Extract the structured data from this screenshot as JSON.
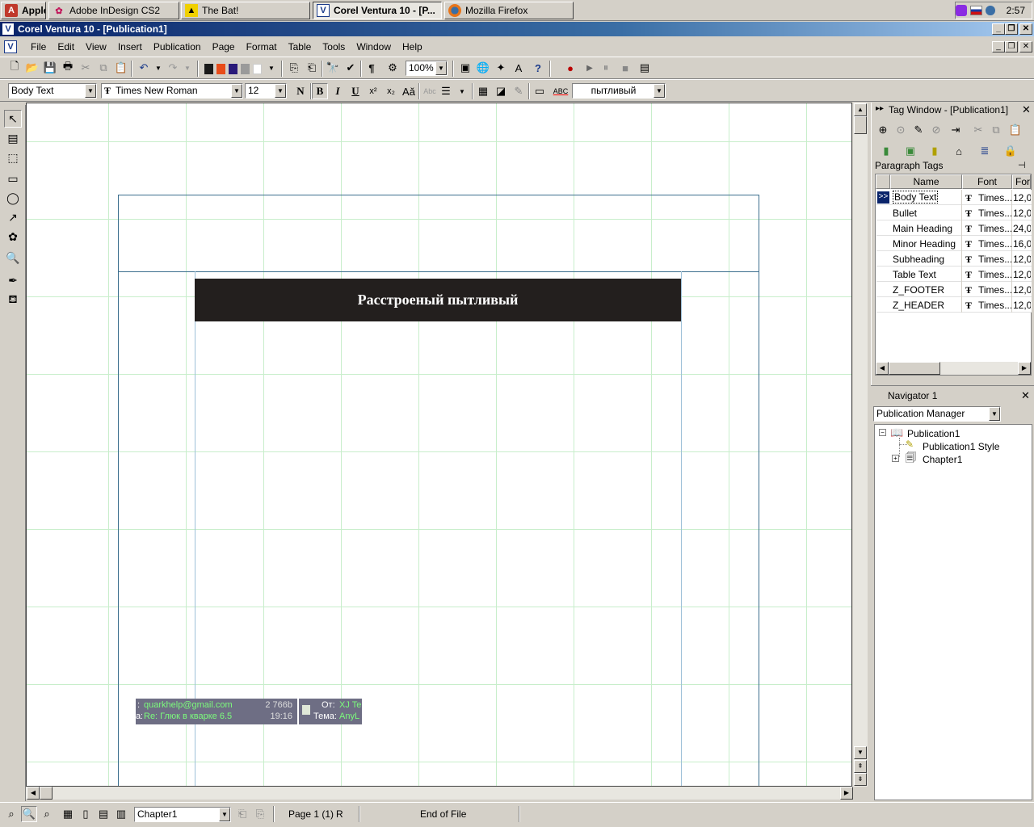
{
  "taskbar": {
    "start_label": "Apple",
    "tasks": [
      {
        "label": "Adobe InDesign CS2"
      },
      {
        "label": "The Bat!"
      },
      {
        "label": "Corel Ventura 10 - [P..."
      },
      {
        "label": "Mozilla Firefox"
      }
    ],
    "clock": "2:57"
  },
  "window": {
    "title": "Corel Ventura 10 - [Publication1]"
  },
  "menu": [
    "File",
    "Edit",
    "View",
    "Insert",
    "Publication",
    "Page",
    "Format",
    "Table",
    "Tools",
    "Window",
    "Help"
  ],
  "toolbar": {
    "zoom": "100%",
    "colors": [
      "#1a1a1a",
      "#e84c1a",
      "#2a1a7a",
      "#9a9a9a",
      "#ffffff"
    ]
  },
  "format_bar": {
    "paragraph_tag": "Body Text",
    "font": "Times New Roman",
    "size": "12",
    "bold": "B",
    "italic": "I",
    "underline": "U",
    "bold_n": "N",
    "spell_word": "пытливый"
  },
  "document": {
    "heading": "Расстроеный пытливый"
  },
  "notification": {
    "left": {
      "email": "quarkhelp@gmail.com",
      "size": "2 766b",
      "subject": "Re: Глюк в кварке 6.5",
      "time": "19:16",
      "email_prefix": ":",
      "subject_prefix": "a:"
    },
    "right": {
      "from_label": "От:",
      "from_value": "XJ Te",
      "subject_label": "Тема:",
      "subject_value": "AnyL"
    }
  },
  "tag_window": {
    "title": "Tag Window - [Publication1]",
    "section": "Paragraph Tags",
    "columns": [
      "Name",
      "Font",
      "For"
    ],
    "rows": [
      {
        "marker": ">>",
        "name": "Body Text",
        "font": "Times...",
        "size": "12,0"
      },
      {
        "marker": "",
        "name": "Bullet",
        "font": "Times...",
        "size": "12,0"
      },
      {
        "marker": "",
        "name": "Main Heading",
        "font": "Times...",
        "size": "24,0"
      },
      {
        "marker": "",
        "name": "Minor Heading",
        "font": "Times...",
        "size": "16,0"
      },
      {
        "marker": "",
        "name": "Subheading",
        "font": "Times...",
        "size": "12,0"
      },
      {
        "marker": "",
        "name": "Table Text",
        "font": "Times...",
        "size": "12,0"
      },
      {
        "marker": "",
        "name": "Z_FOOTER",
        "font": "Times...",
        "size": "12,0"
      },
      {
        "marker": "",
        "name": "Z_HEADER",
        "font": "Times...",
        "size": "12,0"
      }
    ]
  },
  "navigator": {
    "title": "Navigator 1",
    "mode": "Publication Manager",
    "tree": [
      "Publication1",
      "Publication1 Style",
      "Chapter1"
    ]
  },
  "status": {
    "chapter": "Chapter1",
    "page": "Page 1 (1)",
    "mode": "R",
    "position": "End of File"
  }
}
